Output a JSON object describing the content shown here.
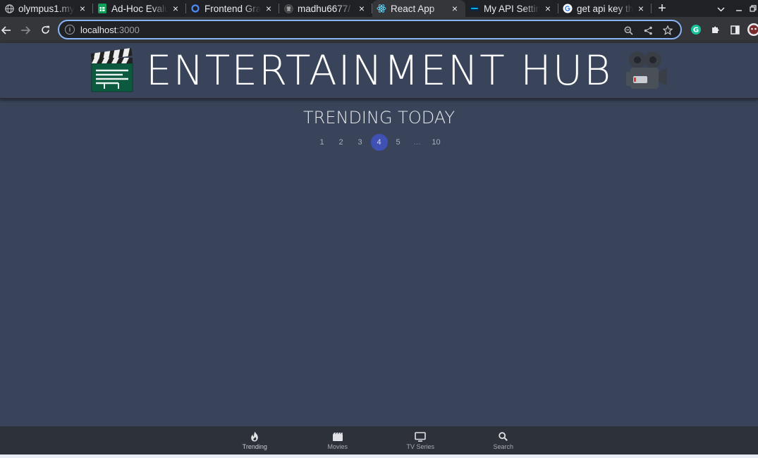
{
  "browser": {
    "tabs": [
      {
        "title": "olympus1.my",
        "favicon": "globe-icon",
        "color": "#bdc1c6",
        "active": false
      },
      {
        "title": "Ad-Hoc Evalu",
        "favicon": "sheets-icon",
        "color": "#0f9d58",
        "active": false
      },
      {
        "title": "Frontend Gra",
        "favicon": "circle-icon",
        "color": "#4c8bf5",
        "active": false
      },
      {
        "title": "madhu6677/",
        "favicon": "github-icon",
        "color": "#bdc1c6",
        "active": false
      },
      {
        "title": "React App",
        "favicon": "react-icon",
        "color": "#61dafb",
        "active": true
      },
      {
        "title": "My API Settin",
        "favicon": "tmdb-icon",
        "color": "#01b4e4",
        "active": false
      },
      {
        "title": "get api key th",
        "favicon": "google-icon",
        "color": "#ffffff",
        "active": false
      }
    ],
    "new_tab_symbol": "+",
    "close_symbol": "×",
    "address": {
      "host": "localhost",
      "port": ":3000"
    }
  },
  "app": {
    "header_title": "ENTERTAINMENT HUB",
    "page_title": "TRENDING TODAY",
    "pagination": {
      "pages": [
        "1",
        "2",
        "3",
        "4",
        "5",
        "…",
        "10"
      ],
      "selected": "4"
    },
    "bottom_nav": [
      {
        "label": "Trending",
        "icon": "whatshot-icon",
        "active": true
      },
      {
        "label": "Movies",
        "icon": "movie-icon",
        "active": false
      },
      {
        "label": "TV Series",
        "icon": "tv-icon",
        "active": false
      },
      {
        "label": "Search",
        "icon": "search-icon",
        "active": false
      }
    ],
    "colors": {
      "background": "#39445a",
      "accent": "#3f51b5",
      "bottom_nav": "#2d313a"
    }
  }
}
